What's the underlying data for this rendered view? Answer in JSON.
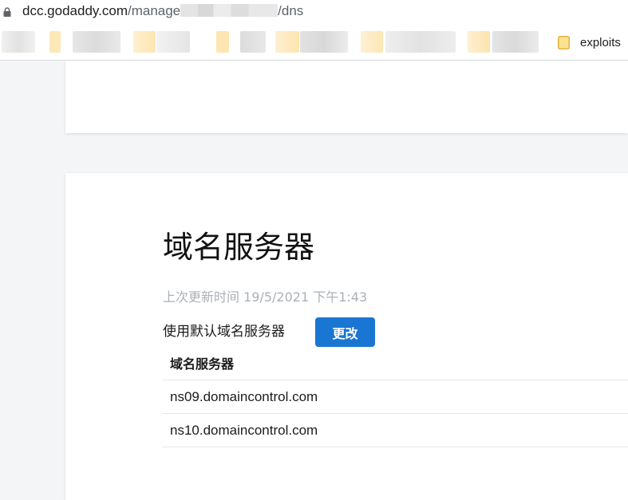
{
  "browser": {
    "url_domain": "dcc.godaddy.com",
    "url_path_start": "/manage",
    "url_path_end": "/dns",
    "bookmark_folder_label": "exploits"
  },
  "dns_card": {
    "title": "域名服务器",
    "last_updated": "上次更新时间 19/5/2021 下午1:43",
    "default_label": "使用默认域名服务器",
    "change_button": "更改",
    "table_header": "域名服务器",
    "nameservers": [
      "ns09.domaincontrol.com",
      "ns10.domaincontrol.com"
    ]
  },
  "colors": {
    "accent": "#1976d2",
    "page_bg": "#f4f5f6",
    "muted_text": "#aab1b8"
  }
}
